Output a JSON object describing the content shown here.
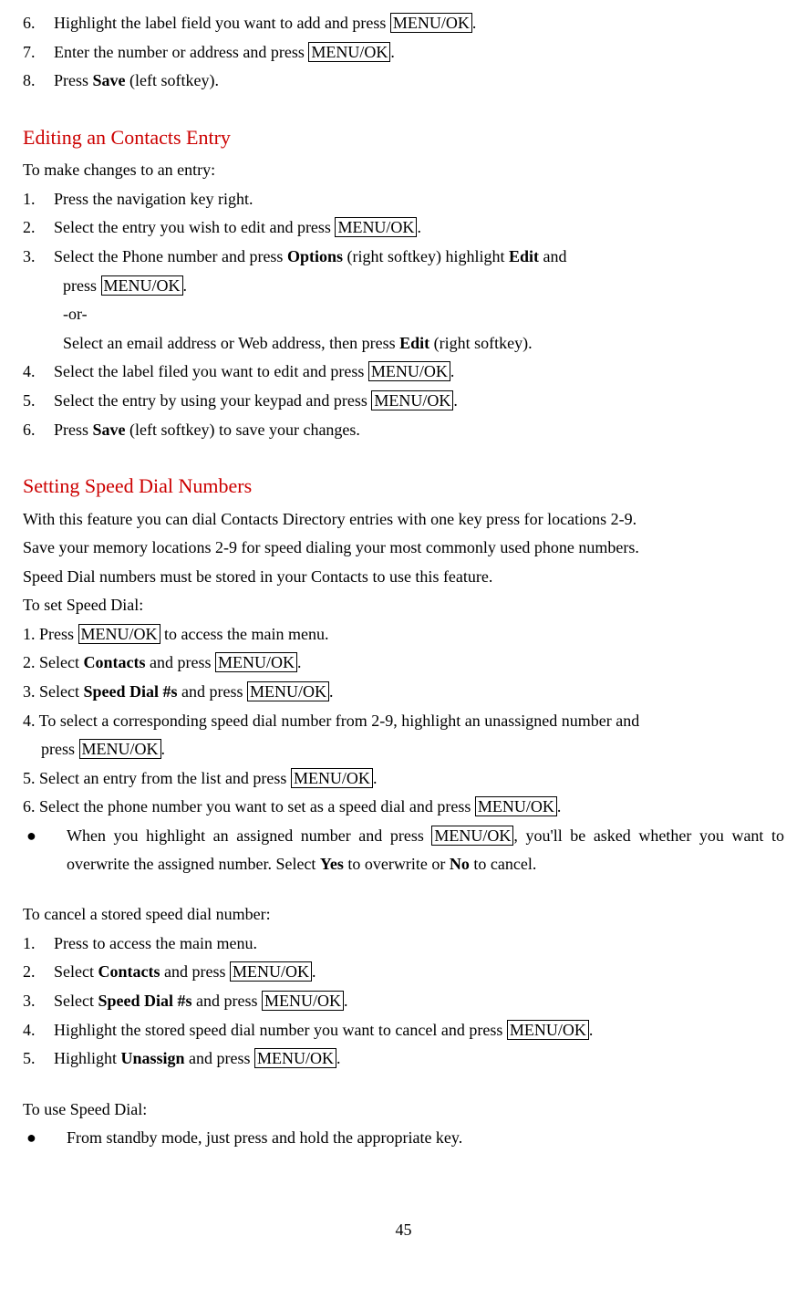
{
  "top_steps": {
    "s6_num": "6.",
    "s6_a": "Highlight the label field you want to add and press ",
    "s6_btn": "MENU/OK",
    "s6_b": ".",
    "s7_num": "7.",
    "s7_a": "Enter the number or address and press ",
    "s7_btn": "MENU/OK",
    "s7_b": ".",
    "s8_num": "8.",
    "s8_a": "Press ",
    "s8_bold": "Save",
    "s8_b": " (left softkey)."
  },
  "edit": {
    "heading": "Editing an Contacts Entry",
    "intro": "To make changes to an entry:",
    "s1_num": "1.",
    "s1": "Press the navigation key right.",
    "s2_num": "2.",
    "s2_a": "Select the entry you wish to edit and press ",
    "s2_btn": "MENU/OK",
    "s2_b": ".",
    "s3_num": "3.",
    "s3_a": "Select the Phone number and press ",
    "s3_bold1": "Options",
    "s3_b": " (right softkey) highlight ",
    "s3_bold2": "Edit",
    "s3_c": " and",
    "s3_line2_a": "press ",
    "s3_line2_btn": "MENU/OK",
    "s3_line2_b": ".",
    "s3_or": "-or-",
    "s3_alt_a": "Select an email address or Web address, then press ",
    "s3_alt_bold": "Edit",
    "s3_alt_b": " (right softkey).",
    "s4_num": "4.",
    "s4_a": "Select the label filed you want to edit and press ",
    "s4_btn": "MENU/OK",
    "s4_b": ".",
    "s5_num": "5.",
    "s5_a": "Select the entry by using your keypad and press ",
    "s5_btn": "MENU/OK",
    "s5_b": ".",
    "s6_num": "6.",
    "s6_a": "Press ",
    "s6_bold": "Save",
    "s6_b": " (left softkey) to save your changes."
  },
  "speed": {
    "heading": "Setting Speed Dial Numbers",
    "intro1": "With this feature you can dial Contacts Directory entries with one key press for locations 2-9.",
    "intro2": "Save your memory locations 2-9 for speed dialing your most commonly used phone numbers.",
    "intro3": "Speed Dial numbers must be stored in your Contacts to use this feature.",
    "intro4": "To set Speed Dial:",
    "s1_a": "1. Press ",
    "s1_btn": "MENU/OK",
    "s1_b": " to access the main menu.",
    "s2_a": "2. Select ",
    "s2_bold": "Contacts",
    "s2_b": " and press ",
    "s2_btn": "MENU/OK",
    "s2_c": ".",
    "s3_a": "3. Select ",
    "s3_bold": "Speed Dial #s",
    "s3_b": " and press ",
    "s3_btn": "MENU/OK",
    "s3_c": ".",
    "s4_a": "4. To select a corresponding speed dial number from 2-9, highlight an unassigned number and",
    "s4_line2_a": "press ",
    "s4_line2_btn": "MENU/OK",
    "s4_line2_b": ".",
    "s5_a": "5. Select an entry from the list and press ",
    "s5_btn": "MENU/OK",
    "s5_b": ".",
    "s6_a": "6. Select the phone number you want to set as a speed dial and press ",
    "s6_btn": "MENU/OK",
    "s6_b": ".",
    "bullet_a": "When you highlight an assigned number and press ",
    "bullet_btn": "MENU/OK",
    "bullet_b": ", you'll be asked whether you want to overwrite the assigned number. Select ",
    "bullet_bold1": "Yes",
    "bullet_c": " to overwrite or ",
    "bullet_bold2": "No",
    "bullet_d": " to cancel."
  },
  "cancel": {
    "intro": "To cancel a stored speed dial number:",
    "s1_num": "1.",
    "s1": "Press to access the main menu.",
    "s2_num": "2.",
    "s2_a": "Select ",
    "s2_bold": "Contacts",
    "s2_b": " and press ",
    "s2_btn": "MENU/OK",
    "s2_c": ".",
    "s3_num": "3.",
    "s3_a": "Select ",
    "s3_bold": "Speed Dial #s",
    "s3_b": " and press ",
    "s3_btn": "MENU/OK",
    "s3_c": ".",
    "s4_num": "4.",
    "s4_a": "Highlight the stored speed dial number you want to cancel and press ",
    "s4_btn": "MENU/OK",
    "s4_b": ".",
    "s5_num": "5.",
    "s5_a": "Highlight ",
    "s5_bold": "Unassign",
    "s5_b": " and press ",
    "s5_btn": "MENU/OK",
    "s5_c": "."
  },
  "use": {
    "intro": "To use Speed Dial:",
    "bullet": "From standby mode, just press and hold the appropriate key."
  },
  "page_num": "45"
}
